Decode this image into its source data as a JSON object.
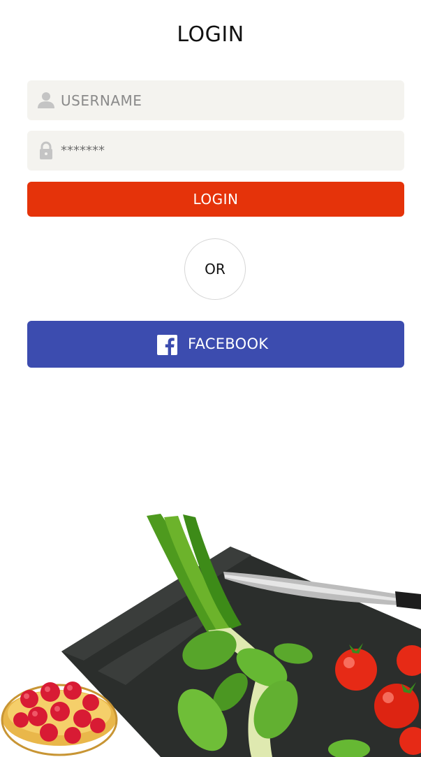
{
  "header": {
    "title": "LOGIN"
  },
  "form": {
    "username": {
      "placeholder": "USERNAME",
      "value": "",
      "icon": "person-icon"
    },
    "password": {
      "value": "*******",
      "icon": "lock-icon"
    },
    "login_label": "LOGIN",
    "or_label": "OR",
    "facebook_label": "FACEBOOK",
    "facebook_icon": "facebook-icon"
  },
  "colors": {
    "accent": "#e5330a",
    "facebook": "#3c4caf",
    "field_bg": "#f4f3ef"
  }
}
